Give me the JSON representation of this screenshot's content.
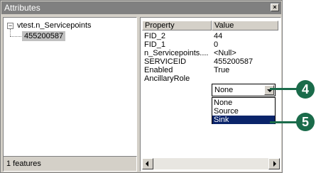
{
  "window": {
    "title": "Attributes",
    "close_glyph": "×"
  },
  "tree": {
    "toggle_glyph": "−",
    "root_label": "vtest.n_Servicepoints",
    "child_label": "455200587"
  },
  "status": {
    "text": "1 features"
  },
  "grid": {
    "headers": {
      "property": "Property",
      "value": "Value"
    },
    "rows": [
      {
        "property": "FID_2",
        "value": "44"
      },
      {
        "property": "FID_1",
        "value": "0"
      },
      {
        "property": "n_Servicepoints....",
        "value": "<Null>"
      },
      {
        "property": "SERVICEID",
        "value": "455200587"
      },
      {
        "property": "Enabled",
        "value": "True"
      },
      {
        "property": "AncillaryRole",
        "value": ""
      }
    ]
  },
  "combo": {
    "selected": "None",
    "options": [
      "None",
      "Source",
      "Sink"
    ],
    "highlighted": "Sink"
  },
  "callouts": {
    "step4": "4",
    "step5": "5"
  },
  "colors": {
    "callout": "#1a6b4a",
    "highlight": "#0a246a",
    "titlebar": "#808080"
  }
}
